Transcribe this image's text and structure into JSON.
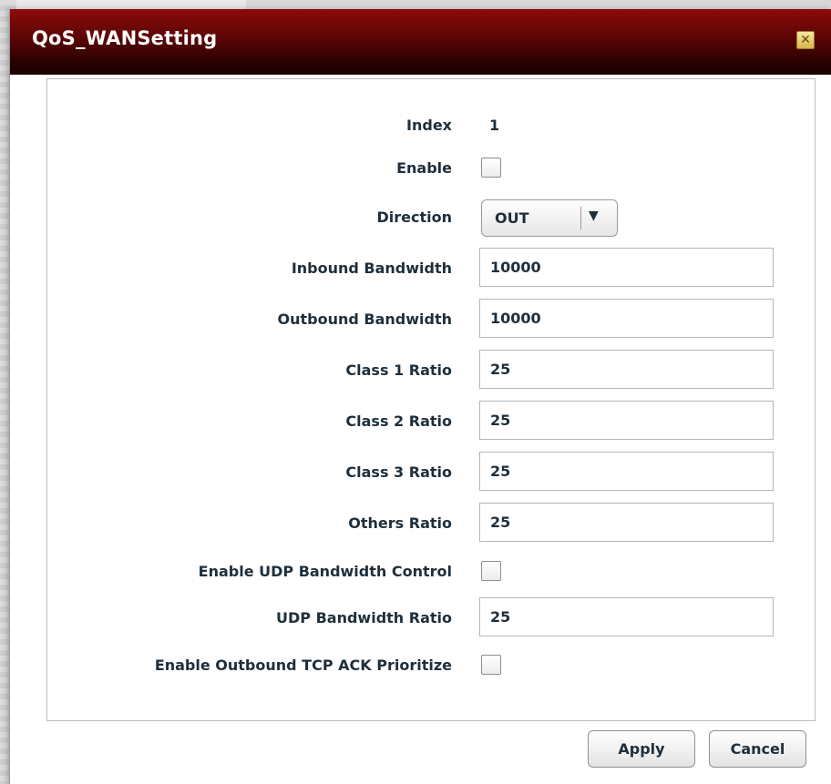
{
  "dialog": {
    "title": "QoS_WANSetting",
    "close_icon": "close-icon"
  },
  "form": {
    "index": {
      "label": "Index",
      "value": "1"
    },
    "enable": {
      "label": "Enable",
      "checked": false
    },
    "direction": {
      "label": "Direction",
      "selected": "OUT"
    },
    "inbound_bandwidth": {
      "label": "Inbound Bandwidth",
      "value": "10000"
    },
    "outbound_bandwidth": {
      "label": "Outbound Bandwidth",
      "value": "10000"
    },
    "class1_ratio": {
      "label": "Class 1 Ratio",
      "value": "25"
    },
    "class2_ratio": {
      "label": "Class 2 Ratio",
      "value": "25"
    },
    "class3_ratio": {
      "label": "Class 3 Ratio",
      "value": "25"
    },
    "others_ratio": {
      "label": "Others Ratio",
      "value": "25"
    },
    "enable_udp_bw_control": {
      "label": "Enable UDP Bandwidth Control",
      "checked": false
    },
    "udp_bandwidth_ratio": {
      "label": "UDP Bandwidth Ratio",
      "value": "25"
    },
    "enable_outbound_tcp_ack": {
      "label": "Enable Outbound TCP ACK Prioritize",
      "checked": false
    }
  },
  "buttons": {
    "apply": "Apply",
    "cancel": "Cancel"
  },
  "colors": {
    "titlebar_top": "#8c0b0b",
    "titlebar_bottom": "#1a0000",
    "label_text": "#1e2f3c"
  }
}
